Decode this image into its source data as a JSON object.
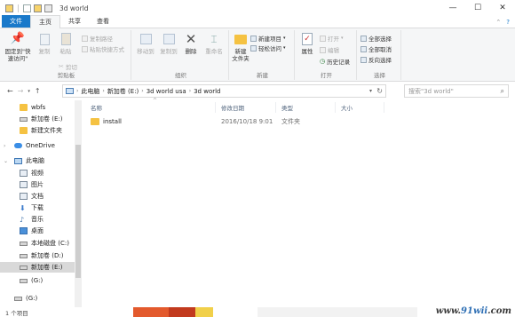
{
  "window": {
    "title": "3d world",
    "controls": [
      "—",
      "☐",
      "✕"
    ]
  },
  "tabs": [
    {
      "label": "文件",
      "kind": "file"
    },
    {
      "label": "主页",
      "kind": "active"
    },
    {
      "label": "共享",
      "kind": "normal"
    },
    {
      "label": "查看",
      "kind": "normal"
    }
  ],
  "ribbon": {
    "clipboard": {
      "label": "剪贴板",
      "pin": "固定到\"快\n速访问\"",
      "copy": "复制",
      "paste": "粘贴",
      "copy_path": "复制路径",
      "paste_shortcut": "粘贴快捷方式",
      "cut": "剪切"
    },
    "organize": {
      "label": "组织",
      "move_to": "移动到",
      "copy_to": "复制到",
      "delete": "删除",
      "rename": "重命名"
    },
    "new": {
      "label": "新建",
      "new_folder": "新建\n文件夹",
      "new_item": "新建项目",
      "easy_access": "轻松访问"
    },
    "open": {
      "label": "打开",
      "properties": "属性",
      "open": "打开",
      "edit": "编辑",
      "history": "历史记录"
    },
    "select": {
      "label": "选择",
      "select_all": "全部选择",
      "select_none": "全部取消",
      "invert": "反向选择"
    }
  },
  "address": {
    "crumbs": [
      "此电脑",
      "新加卷 (E:)",
      "3d world usa",
      "3d world"
    ],
    "search_placeholder": "搜索\"3d world\""
  },
  "sidebar": {
    "items": [
      {
        "label": "wbfs",
        "icon": "folder-icon",
        "indent": 1,
        "selected": false
      },
      {
        "label": "新加卷 (E:)",
        "icon": "drive-icon",
        "indent": 1,
        "selected": false
      },
      {
        "label": "新建文件夹",
        "icon": "folder-icon",
        "indent": 1,
        "selected": false
      },
      {
        "label": "OneDrive",
        "icon": "cloud-icon",
        "indent": 0,
        "selected": false
      },
      {
        "label": "此电脑",
        "icon": "pc-icon",
        "indent": 0,
        "selected": false
      },
      {
        "label": "视频",
        "icon": "video-icon",
        "indent": 1,
        "selected": false
      },
      {
        "label": "图片",
        "icon": "picture-icon",
        "indent": 1,
        "selected": false
      },
      {
        "label": "文档",
        "icon": "document-icon",
        "indent": 1,
        "selected": false
      },
      {
        "label": "下载",
        "icon": "download-icon",
        "indent": 1,
        "selected": false
      },
      {
        "label": "音乐",
        "icon": "music-icon",
        "indent": 1,
        "selected": false
      },
      {
        "label": "桌面",
        "icon": "desktop-icon",
        "indent": 1,
        "selected": false
      },
      {
        "label": "本地磁盘 (C:)",
        "icon": "drive-icon",
        "indent": 1,
        "selected": false
      },
      {
        "label": "新加卷 (D:)",
        "icon": "drive-icon",
        "indent": 1,
        "selected": false
      },
      {
        "label": "新加卷 (E:)",
        "icon": "drive-icon",
        "indent": 1,
        "selected": true
      },
      {
        "label": "(G:)",
        "icon": "drive-icon",
        "indent": 1,
        "selected": false
      },
      {
        "label": "(G:)",
        "icon": "drive-icon",
        "indent": 1,
        "selected": false
      }
    ]
  },
  "columns": {
    "name": "名称",
    "modified": "修改日期",
    "type": "类型",
    "size": "大小"
  },
  "files": [
    {
      "name": "install",
      "modified": "2016/10/18 9:01",
      "type": "文件夹",
      "size": ""
    }
  ],
  "status": {
    "count": "1 个项目"
  },
  "watermark": {
    "prefix": "www.",
    "brand": "91wii",
    "suffix": ".com"
  }
}
